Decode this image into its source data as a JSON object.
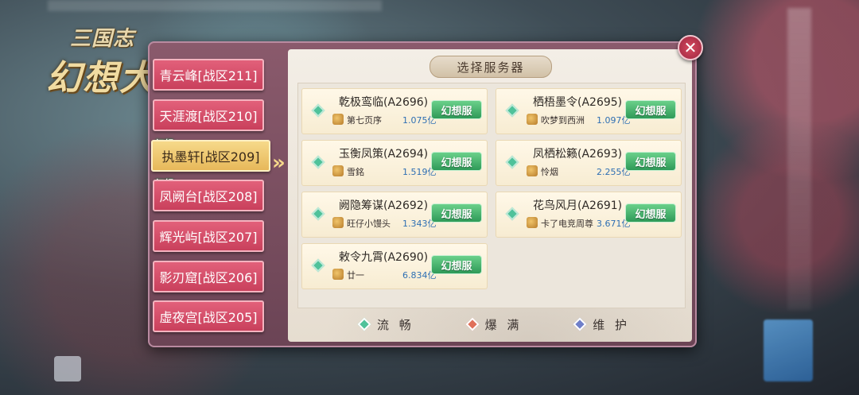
{
  "game": {
    "logo_sub": "三国志",
    "logo_main": "幻想大陆"
  },
  "dialog": {
    "title": "选择服务器",
    "close_icon": "close-icon"
  },
  "tabs": [
    {
      "label": "青云峰[战区211]",
      "selected": false,
      "badge": ""
    },
    {
      "label": "天涯渡[战区210]",
      "selected": false,
      "badge": ""
    },
    {
      "label": "执墨轩[战区209]",
      "selected": true,
      "badge": "幻想"
    },
    {
      "label": "凤阙台[战区208]",
      "selected": false,
      "badge": "幻想"
    },
    {
      "label": "辉光屿[战区207]",
      "selected": false,
      "badge": ""
    },
    {
      "label": "影刃窟[战区206]",
      "selected": false,
      "badge": ""
    },
    {
      "label": "虚夜宫[战区205]",
      "selected": false,
      "badge": ""
    }
  ],
  "servers": [
    {
      "name": "乾极鸾临(A2696)",
      "owner": "第七页序",
      "power": "1.075亿",
      "badge": "幻想服",
      "status": "smooth"
    },
    {
      "name": "栖梧墨令(A2695)",
      "owner": "吹梦到西洲",
      "power": "1.097亿",
      "badge": "幻想服",
      "status": "smooth"
    },
    {
      "name": "玉衡凤策(A2694)",
      "owner": "雪銘",
      "power": "1.519亿",
      "badge": "幻想服",
      "status": "smooth"
    },
    {
      "name": "凤栖松籁(A2693)",
      "owner": "怜烟",
      "power": "2.255亿",
      "badge": "幻想服",
      "status": "smooth"
    },
    {
      "name": "阙隐筹谋(A2692)",
      "owner": "旺仔小馒头",
      "power": "1.343亿",
      "badge": "幻想服",
      "status": "smooth"
    },
    {
      "name": "花鸟风月(A2691)",
      "owner": "卡了电竞周尊",
      "power": "3.671亿",
      "badge": "幻想服",
      "status": "smooth"
    },
    {
      "name": "敕令九霄(A2690)",
      "owner": "廿一",
      "power": "6.834亿",
      "badge": "幻想服",
      "status": "smooth"
    }
  ],
  "legend": [
    {
      "label": "流 畅",
      "color": "#4fc29a"
    },
    {
      "label": "爆 满",
      "color": "#e0705a"
    },
    {
      "label": "维 护",
      "color": "#6f7fc9"
    }
  ],
  "colors": {
    "tab_normal": "#d04a65",
    "tab_selected": "#f0c870",
    "badge_green": "#3fae66",
    "power_blue": "#2f6fb3"
  }
}
